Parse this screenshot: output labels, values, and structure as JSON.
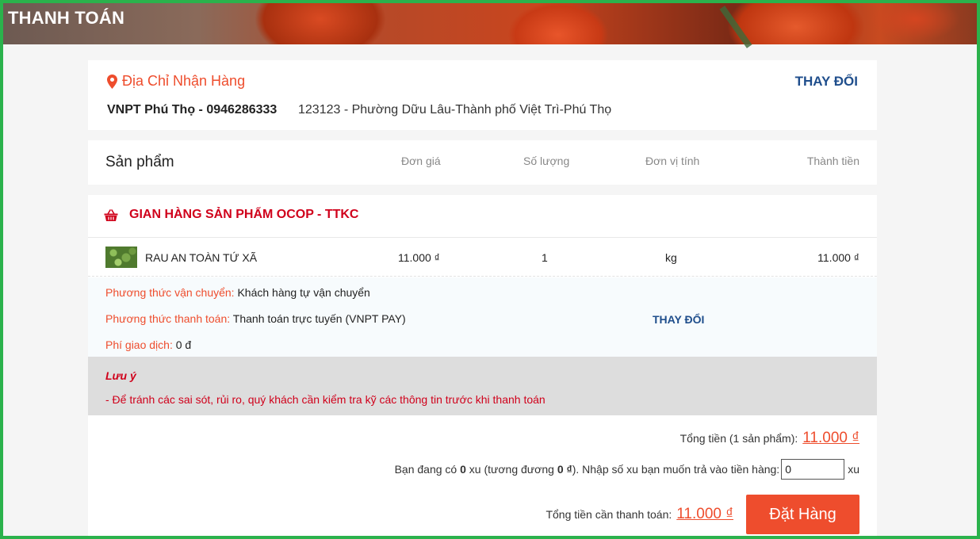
{
  "page": {
    "title": "THANH TOÁN"
  },
  "address": {
    "heading": "Địa Chỉ Nhận Hàng",
    "change_label": "THAY ĐỔI",
    "name_phone": "VNPT Phú Thọ - 0946286333",
    "detail": "123123 - Phường Dữu Lâu-Thành phố Việt Trì-Phú Thọ"
  },
  "columns": {
    "product": "Sản phẩm",
    "unit_price": "Đơn giá",
    "quantity": "Số lượng",
    "unit": "Đơn vị tính",
    "subtotal": "Thành tiền"
  },
  "shop": {
    "name": "GIAN HÀNG SẢN PHẨM OCOP - TTKC",
    "items": [
      {
        "name": "RAU AN TOÀN TỨ XÃ",
        "unit_price": "11.000 ₫",
        "quantity": "1",
        "unit": "kg",
        "subtotal": "11.000 ₫"
      }
    ],
    "shipping_label": "Phương thức vận chuyển:",
    "shipping_value": "Khách hàng tự vận chuyển",
    "payment_label": "Phương thức thanh toán:",
    "payment_value": "Thanh toán trực tuyến (VNPT PAY)",
    "payment_change": "THAY ĐỔI",
    "fee_label": "Phí giao dịch:",
    "fee_value": "0 đ"
  },
  "note": {
    "title": "Lưu ý",
    "text": "- Để tránh các sai sót, rủi ro, quý khách cần kiểm tra kỹ các thông tin trước khi thanh toán"
  },
  "totals": {
    "total_label": "Tổng tiền (1 sản phẩm):",
    "total_value": "11.000 ₫",
    "xu_prefix": "Bạn đang có",
    "xu_have": "0",
    "xu_mid": "xu (tương đương",
    "xu_equiv": "0 ₫",
    "xu_suffix": "). Nhập số xu bạn muốn trả vào tiền hàng:",
    "xu_input_value": "0",
    "xu_unit": "xu",
    "pay_label": "Tổng tiền cần thanh toán:",
    "pay_value": "11.000 ₫",
    "order_button": "Đặt Hàng"
  },
  "colors": {
    "accent": "#ee4d2d",
    "link": "#1f4e8c",
    "shop": "#d0011b",
    "frame": "#2bb24c"
  }
}
